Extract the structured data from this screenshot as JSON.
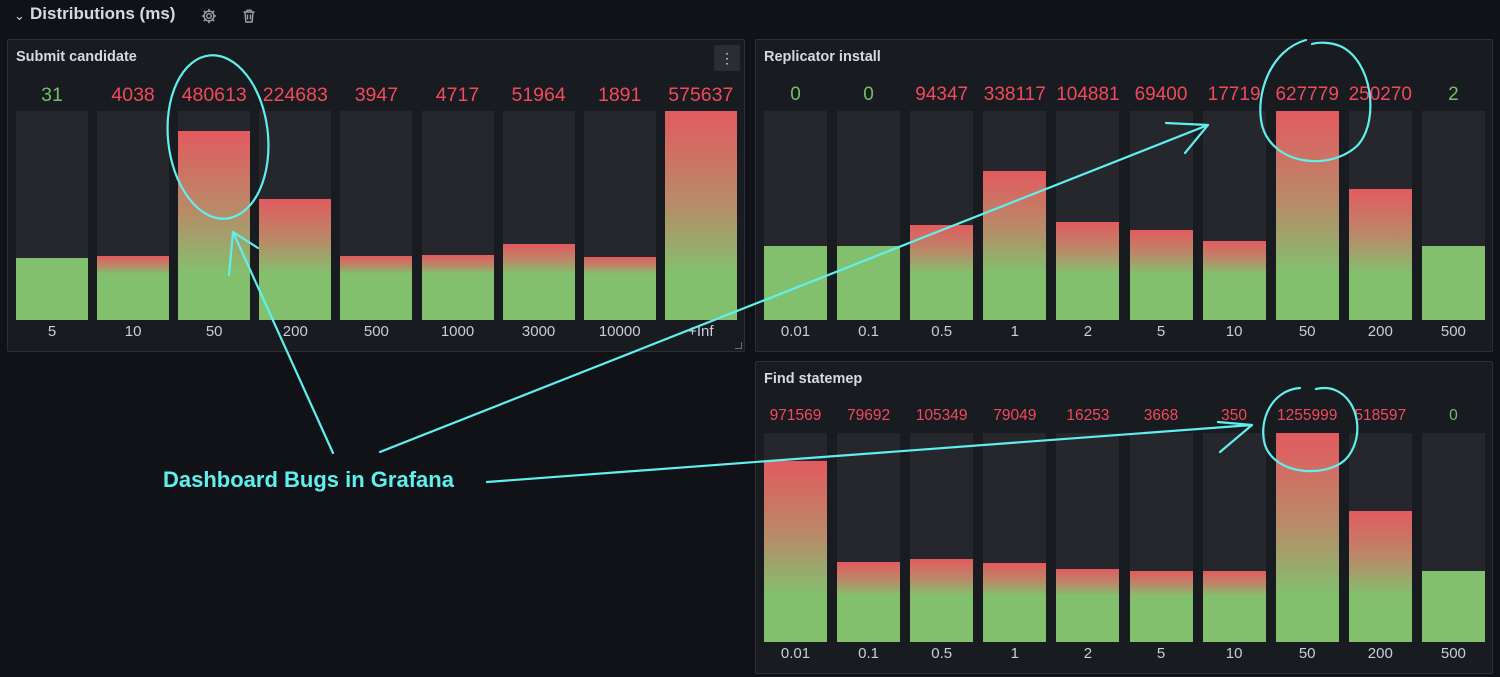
{
  "row": {
    "title": "Distributions (ms)",
    "chevron": "⌄",
    "icons": [
      "gear-icon",
      "trash-icon"
    ]
  },
  "colors": {
    "green": "#73bf69",
    "red": "#f2495c",
    "fill_red": "#e35a60",
    "fill_green": "#83c06e",
    "annotation": "#5ff0ee"
  },
  "annotation": {
    "text": "Dashboard Bugs in Grafana"
  },
  "panels": [
    {
      "title": "Submit candidate",
      "has_menu": true,
      "bars": [
        {
          "label": "5",
          "value": "31",
          "status": "green",
          "level": 0.295
        },
        {
          "label": "10",
          "value": "4038",
          "status": "red",
          "level": 0.305
        },
        {
          "label": "50",
          "value": "480613",
          "status": "red",
          "level": 0.905
        },
        {
          "label": "200",
          "value": "224683",
          "status": "red",
          "level": 0.58
        },
        {
          "label": "500",
          "value": "3947",
          "status": "red",
          "level": 0.305
        },
        {
          "label": "1000",
          "value": "4717",
          "status": "red",
          "level": 0.31
        },
        {
          "label": "3000",
          "value": "51964",
          "status": "red",
          "level": 0.365
        },
        {
          "label": "10000",
          "value": "1891",
          "status": "red",
          "level": 0.3
        },
        {
          "label": "+Inf",
          "value": "575637",
          "status": "red",
          "level": 1.0
        }
      ]
    },
    {
      "title": "Replicator install",
      "has_menu": false,
      "bars": [
        {
          "label": "0.01",
          "value": "0",
          "status": "green",
          "level": 0.355
        },
        {
          "label": "0.1",
          "value": "0",
          "status": "green",
          "level": 0.355
        },
        {
          "label": "0.5",
          "value": "94347",
          "status": "red",
          "level": 0.455
        },
        {
          "label": "1",
          "value": "338117",
          "status": "red",
          "level": 0.715
        },
        {
          "label": "2",
          "value": "104881",
          "status": "red",
          "level": 0.47
        },
        {
          "label": "5",
          "value": "69400",
          "status": "red",
          "level": 0.43
        },
        {
          "label": "10",
          "value": "17719",
          "status": "red",
          "level": 0.38
        },
        {
          "label": "50",
          "value": "627779",
          "status": "red",
          "level": 1.0
        },
        {
          "label": "200",
          "value": "250270",
          "status": "red",
          "level": 0.625
        },
        {
          "label": "500",
          "value": "2",
          "status": "green",
          "level": 0.355
        }
      ]
    },
    {
      "title": "Find statemep",
      "has_menu": false,
      "bars": [
        {
          "label": "0.01",
          "value": "971569",
          "status": "red",
          "level": 0.865
        },
        {
          "label": "0.1",
          "value": "79692",
          "status": "red",
          "level": 0.385
        },
        {
          "label": "0.5",
          "value": "105349",
          "status": "red",
          "level": 0.395
        },
        {
          "label": "1",
          "value": "79049",
          "status": "red",
          "level": 0.38
        },
        {
          "label": "2",
          "value": "16253",
          "status": "red",
          "level": 0.35
        },
        {
          "label": "5",
          "value": "3668",
          "status": "red",
          "level": 0.34
        },
        {
          "label": "10",
          "value": "350",
          "status": "red",
          "level": 0.34
        },
        {
          "label": "50",
          "value": "1255999",
          "status": "red",
          "level": 1.0
        },
        {
          "label": "200",
          "value": "518597",
          "status": "red",
          "level": 0.625
        },
        {
          "label": "500",
          "value": "0",
          "status": "green",
          "level": 0.34
        }
      ]
    }
  ]
}
